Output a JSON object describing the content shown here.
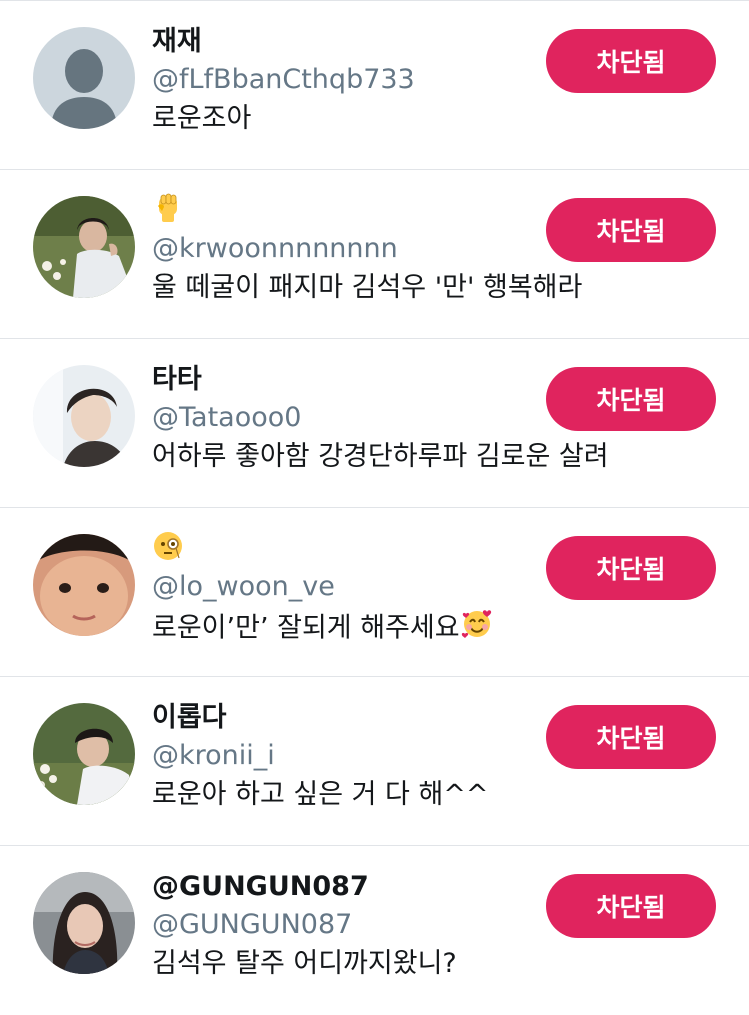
{
  "block_button_label": "차단됨",
  "colors": {
    "accent": "#e0245e",
    "handle": "#657786",
    "divider": "#e1e4e8"
  },
  "users": [
    {
      "name": "재재",
      "handle": "@fLfBbanCthqb733",
      "bio": "로운조아",
      "avatar": "default-avatar"
    },
    {
      "name": "",
      "name_icon": "raised-fist-emoji",
      "handle": "@krwoonnnnnnnn",
      "bio": "울 떼굴이 패지마 김석우 '만' 행복해라",
      "avatar": "photo-avatar"
    },
    {
      "name": "타타",
      "handle": "@Tataooo0",
      "bio": "어하루 좋아함 강경단하루파 김로운 살려",
      "avatar": "photo-avatar"
    },
    {
      "name": "",
      "name_icon": "face-with-monocle-emoji",
      "handle": "@lo_woon_ve",
      "bio": "로운이’만’ 잘되게 해주세요",
      "bio_icon": "smiling-face-with-hearts-emoji",
      "avatar": "photo-avatar"
    },
    {
      "name": "이롭다",
      "handle": "@kronii_i",
      "bio": "로운아 하고 싶은 거 다 해^^",
      "avatar": "photo-avatar"
    },
    {
      "name": "@GUNGUN087",
      "handle": "@GUNGUN087",
      "bio": "김석우 탈주 어디까지왔니?",
      "avatar": "photo-avatar"
    }
  ]
}
